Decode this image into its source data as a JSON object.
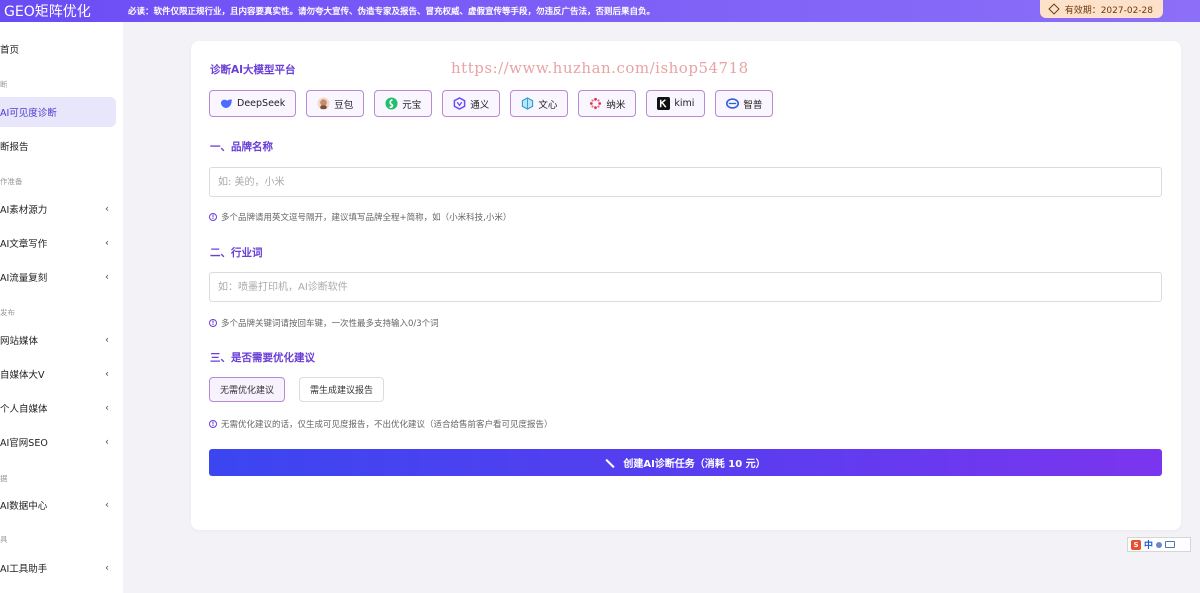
{
  "topbar": {
    "brand": "GEO矩阵优化",
    "notice": "必读：软件仅限正规行业，且内容要真实性。请勿夸大宣传、伪造专家及报告、冒充权威、虚假宣传等手段，勿违反广告法，否则后果自负。",
    "validity": "有效期：2027-02-28"
  },
  "sidebar": {
    "home": "首页",
    "groups": [
      "断",
      "作准备",
      "发布",
      "据",
      "具"
    ],
    "items": [
      {
        "label": "AI可见度诊断"
      },
      {
        "label": "诊断报告"
      },
      {
        "label": "AI素材源力"
      },
      {
        "label": "AI文章写作"
      },
      {
        "label": "AI流量复刻"
      },
      {
        "label": "网站媒体"
      },
      {
        "label": "自媒体大V"
      },
      {
        "label": "个人自媒体"
      },
      {
        "label": "AI官网SEO"
      },
      {
        "label": "AI数据中心"
      },
      {
        "label": "AI工具助手"
      }
    ],
    "items_display": [
      "AI可见度诊断",
      "断报告",
      "AI素材源力",
      "AI文章写作",
      "AI流量复刻",
      "网站媒体",
      "自媒体大V",
      "个人自媒体",
      "AI官网SEO",
      "AI数据中心",
      "AI工具助手"
    ]
  },
  "form": {
    "platform_title": "诊断AI大模型平台",
    "watermark": "https://www.huzhan.com/ishop54718",
    "platforms": [
      {
        "label": "DeepSeek",
        "icon": "deepseek-icon",
        "color": "#4d6bfe"
      },
      {
        "label": "豆包",
        "icon": "doubao-icon",
        "color": "#c58b6a"
      },
      {
        "label": "元宝",
        "icon": "yuanbao-icon",
        "color": "#1fbf6b"
      },
      {
        "label": "通义",
        "icon": "tongyi-icon",
        "color": "#6a4cf5"
      },
      {
        "label": "文心",
        "icon": "wenxin-icon",
        "color": "#2e9ad9"
      },
      {
        "label": "纳米",
        "icon": "nami-icon",
        "color": "#e0304a"
      },
      {
        "label": "kimi",
        "icon": "kimi-icon",
        "color": "#111111"
      },
      {
        "label": "智普",
        "icon": "zhipu-icon",
        "color": "#2f5fe0"
      }
    ],
    "brand_title": "一、品牌名称",
    "brand_placeholder": "如: 美的，小米",
    "brand_hint": "多个品牌请用英文逗号隔开，建议填写品牌全程+简称，如（小米科技,小米）",
    "industry_title": "二、行业词",
    "industry_placeholder": "如：喷墨打印机，AI诊断软件",
    "industry_hint": "多个品牌关键词请按回车键，一次性最多支持输入0/3个词",
    "advice_title": "三、是否需要优化建议",
    "advice_options": [
      "无需优化建议",
      "需生成建议报告"
    ],
    "advice_selected": "无需优化建议",
    "advice_hint": "无需优化建议的话，仅生成可见度报告，不出优化建议（适合给售前客户看可见度报告）",
    "submit_label": "创建AI诊断任务（消耗  10 元）"
  },
  "ime": {
    "label": "中"
  },
  "colors": {
    "accent": "#6a3fd6",
    "topbar": "#7b5cf7",
    "submit_start": "#3b46f0",
    "submit_end": "#7b35ee"
  }
}
